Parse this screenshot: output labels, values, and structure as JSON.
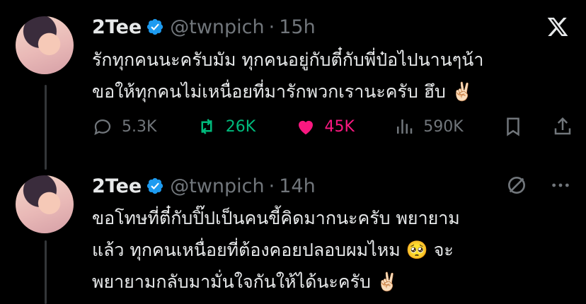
{
  "tweets": [
    {
      "author": {
        "name": "2Tee",
        "handle": "@twnpich"
      },
      "time": "15h",
      "separator": "·",
      "text": "รักทุกคนนะครับมัม ทุกคนอยู่กับตี๋กับพี่ป๋อไปนานๆน้า\nขอให้ทุกคนไม่เหนื่อยที่มารักพวกเรานะครับ ฮึบ ✌🏻",
      "metrics": {
        "replies": "5.3K",
        "reposts": "26K",
        "likes": "45K",
        "views": "590K"
      }
    },
    {
      "author": {
        "name": "2Tee",
        "handle": "@twnpich"
      },
      "time": "14h",
      "separator": "·",
      "text": "ขอโทษที่ตี๋กับปิ๊ปเป็นคนขี้คิดมากนะครับ พยายาม\nแล้ว ทุกคนเหนื่อยที่ต้องคอยปลอบผมไหม 🥺 จะ\nพยายามกลับมามั่นใจกันให้ได้นะครับ ✌🏻"
    }
  ],
  "colors": {
    "background": "#000000",
    "text": "#e7e9ea",
    "muted": "#71767b",
    "verified": "#1d9bf0",
    "repost": "#00ba7c",
    "like": "#f91880"
  },
  "icons": {
    "brand": "x-logo-icon",
    "reply": "reply-icon",
    "repost": "repost-icon",
    "like": "heart-icon",
    "views": "views-icon",
    "bookmark": "bookmark-icon",
    "share": "share-icon",
    "grok": "grok-icon",
    "more": "more-icon",
    "verified": "verified-badge-icon"
  }
}
